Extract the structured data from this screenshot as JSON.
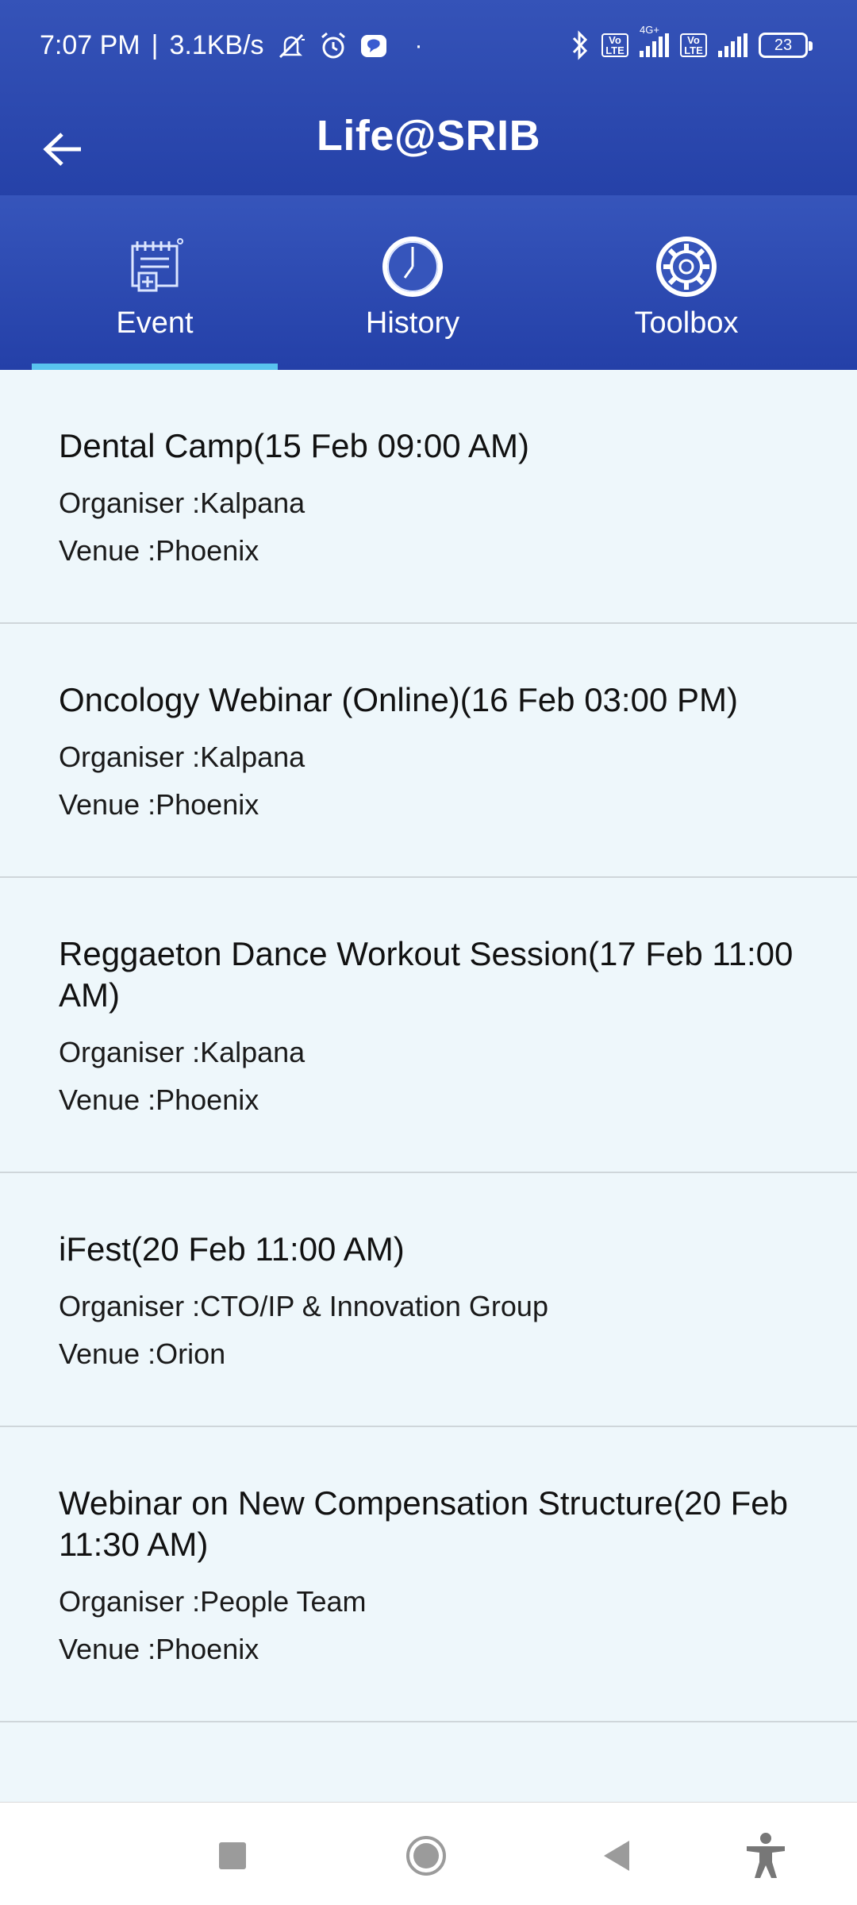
{
  "status_bar": {
    "time": "7:07 PM",
    "speed": "3.1KB/s",
    "network_label": "4G+",
    "volte_label": "Vo LTE",
    "battery": "23",
    "icons": [
      "mute-icon",
      "alarm-icon",
      "message-icon",
      "bluetooth-icon",
      "signal-icon",
      "battery-icon"
    ]
  },
  "app_bar": {
    "title": "Life@SRIB",
    "back_icon": "back-arrow-icon"
  },
  "tabs": [
    {
      "label": "Event",
      "icon": "event-icon",
      "selected": true
    },
    {
      "label": "History",
      "icon": "clock-icon",
      "selected": false
    },
    {
      "label": "Toolbox",
      "icon": "gear-icon",
      "selected": false
    }
  ],
  "events": [
    {
      "title": "Dental Camp(15 Feb 09:00 AM)",
      "organiser": "Organiser :Kalpana",
      "venue": "Venue :Phoenix"
    },
    {
      "title": "Oncology Webinar (Online)(16 Feb 03:00 PM)",
      "organiser": "Organiser :Kalpana",
      "venue": "Venue :Phoenix"
    },
    {
      "title": "Reggaeton Dance Workout Session(17 Feb 11:00 AM)",
      "organiser": "Organiser :Kalpana",
      "venue": "Venue :Phoenix"
    },
    {
      "title": "iFest(20 Feb 11:00 AM)",
      "organiser": "Organiser :CTO/IP & Innovation Group",
      "venue": "Venue :Orion"
    },
    {
      "title": "Webinar on New Compensation Structure(20 Feb 11:30 AM)",
      "organiser": "Organiser :People Team",
      "venue": "Venue :Phoenix"
    }
  ],
  "nav_bar": {
    "icons": [
      "recents-icon",
      "home-icon",
      "back-icon",
      "accessibility-icon"
    ]
  },
  "colors": {
    "header": "#2a46ad",
    "tab_indicator": "#58c4ef",
    "list_background": "#eef7fb",
    "divider": "#cfd6da"
  }
}
